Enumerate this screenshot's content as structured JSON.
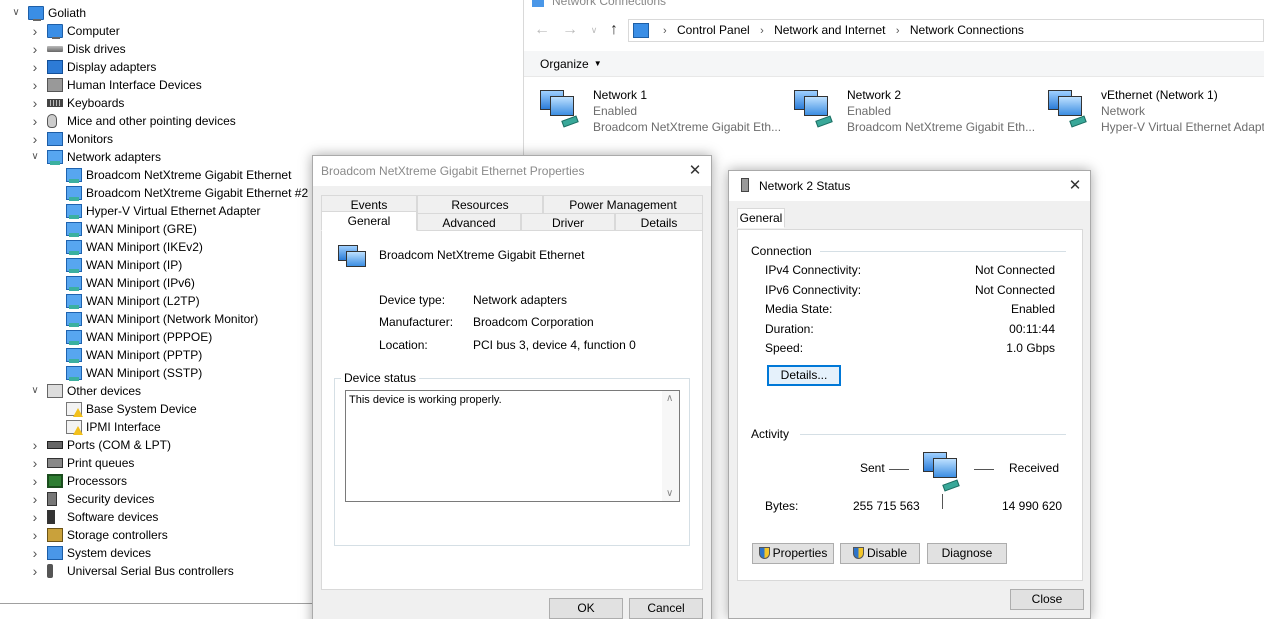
{
  "device_manager": {
    "root": "Goliath",
    "items": [
      {
        "label": "Computer",
        "icon": "computer-icon",
        "expanded": false
      },
      {
        "label": "Disk drives",
        "icon": "disk-drive-icon",
        "expanded": false
      },
      {
        "label": "Display adapters",
        "icon": "display-adapter-icon",
        "expanded": false
      },
      {
        "label": "Human Interface Devices",
        "icon": "hid-icon",
        "expanded": false
      },
      {
        "label": "Keyboards",
        "icon": "keyboard-icon",
        "expanded": false
      },
      {
        "label": "Mice and other pointing devices",
        "icon": "mouse-icon",
        "expanded": false
      },
      {
        "label": "Monitors",
        "icon": "monitor-icon",
        "expanded": false
      },
      {
        "label": "Network adapters",
        "icon": "network-adapter-icon",
        "expanded": true
      },
      {
        "label": "Broadcom NetXtreme Gigabit Ethernet",
        "icon": "network-adapter-icon",
        "child": true
      },
      {
        "label": "Broadcom NetXtreme Gigabit Ethernet #2",
        "icon": "network-adapter-icon",
        "child": true
      },
      {
        "label": "Hyper-V Virtual Ethernet Adapter",
        "icon": "network-adapter-icon",
        "child": true
      },
      {
        "label": "WAN Miniport (GRE)",
        "icon": "network-adapter-icon",
        "child": true
      },
      {
        "label": "WAN Miniport (IKEv2)",
        "icon": "network-adapter-icon",
        "child": true
      },
      {
        "label": "WAN Miniport (IP)",
        "icon": "network-adapter-icon",
        "child": true
      },
      {
        "label": "WAN Miniport (IPv6)",
        "icon": "network-adapter-icon",
        "child": true
      },
      {
        "label": "WAN Miniport (L2TP)",
        "icon": "network-adapter-icon",
        "child": true
      },
      {
        "label": "WAN Miniport (Network Monitor)",
        "icon": "network-adapter-icon",
        "child": true
      },
      {
        "label": "WAN Miniport (PPPOE)",
        "icon": "network-adapter-icon",
        "child": true
      },
      {
        "label": "WAN Miniport (PPTP)",
        "icon": "network-adapter-icon",
        "child": true
      },
      {
        "label": "WAN Miniport (SSTP)",
        "icon": "network-adapter-icon",
        "child": true
      },
      {
        "label": "Other devices",
        "icon": "other-devices-icon",
        "expanded": true
      },
      {
        "label": "Base System Device",
        "icon": "warning-device-icon",
        "child": true
      },
      {
        "label": "IPMI Interface",
        "icon": "warning-device-icon",
        "child": true
      },
      {
        "label": "Ports (COM & LPT)",
        "icon": "port-icon",
        "expanded": false
      },
      {
        "label": "Print queues",
        "icon": "printer-icon",
        "expanded": false
      },
      {
        "label": "Processors",
        "icon": "processor-icon",
        "expanded": false
      },
      {
        "label": "Security devices",
        "icon": "security-device-icon",
        "expanded": false
      },
      {
        "label": "Software devices",
        "icon": "software-device-icon",
        "expanded": false
      },
      {
        "label": "Storage controllers",
        "icon": "storage-controller-icon",
        "expanded": false
      },
      {
        "label": "System devices",
        "icon": "system-device-icon",
        "expanded": false
      },
      {
        "label": "Universal Serial Bus controllers",
        "icon": "usb-icon",
        "expanded": false
      }
    ]
  },
  "network_connections": {
    "window_title": "Network Connections",
    "breadcrumb": [
      "Control Panel",
      "Network and Internet",
      "Network Connections"
    ],
    "organize_label": "Organize",
    "connections": [
      {
        "name": "Network 1",
        "status": "Enabled",
        "device": "Broadcom NetXtreme Gigabit Eth..."
      },
      {
        "name": "Network 2",
        "status": "Enabled",
        "device": "Broadcom NetXtreme Gigabit Eth..."
      },
      {
        "name": "vEthernet (Network 1)",
        "status": "Network",
        "device": "Hyper-V Virtual Ethernet Adapt"
      }
    ]
  },
  "properties_dialog": {
    "title": "Broadcom NetXtreme Gigabit Ethernet Properties",
    "tabs_row1": [
      "Events",
      "Resources",
      "Power Management"
    ],
    "tabs_row2": [
      "General",
      "Advanced",
      "Driver",
      "Details"
    ],
    "active_tab": "General",
    "device_name": "Broadcom NetXtreme Gigabit Ethernet",
    "fields": [
      {
        "label": "Device type:",
        "value": "Network adapters"
      },
      {
        "label": "Manufacturer:",
        "value": "Broadcom Corporation"
      },
      {
        "label": "Location:",
        "value": "PCI bus 3, device 4, function 0"
      }
    ],
    "device_status_label": "Device status",
    "device_status_text": "This device is working properly.",
    "ok_label": "OK",
    "cancel_label": "Cancel"
  },
  "status_dialog": {
    "title": "Network 2 Status",
    "tab": "General",
    "connection_header": "Connection",
    "rows": [
      {
        "label": "IPv4 Connectivity:",
        "value": "Not Connected"
      },
      {
        "label": "IPv6 Connectivity:",
        "value": "Not Connected"
      },
      {
        "label": "Media State:",
        "value": "Enabled"
      },
      {
        "label": "Duration:",
        "value": "00:11:44"
      },
      {
        "label": "Speed:",
        "value": "1.0 Gbps"
      }
    ],
    "details_label": "Details...",
    "activity_header": "Activity",
    "sent_label": "Sent",
    "received_label": "Received",
    "bytes_label": "Bytes:",
    "bytes_sent": "255 715 563",
    "bytes_received": "14 990 620",
    "properties_label": "Properties",
    "disable_label": "Disable",
    "diagnose_label": "Diagnose",
    "close_label": "Close"
  },
  "colors": {
    "accent": "#0078d7",
    "dialog_bg": "#f0f0f0",
    "muted_text": "#6d6d6d"
  }
}
